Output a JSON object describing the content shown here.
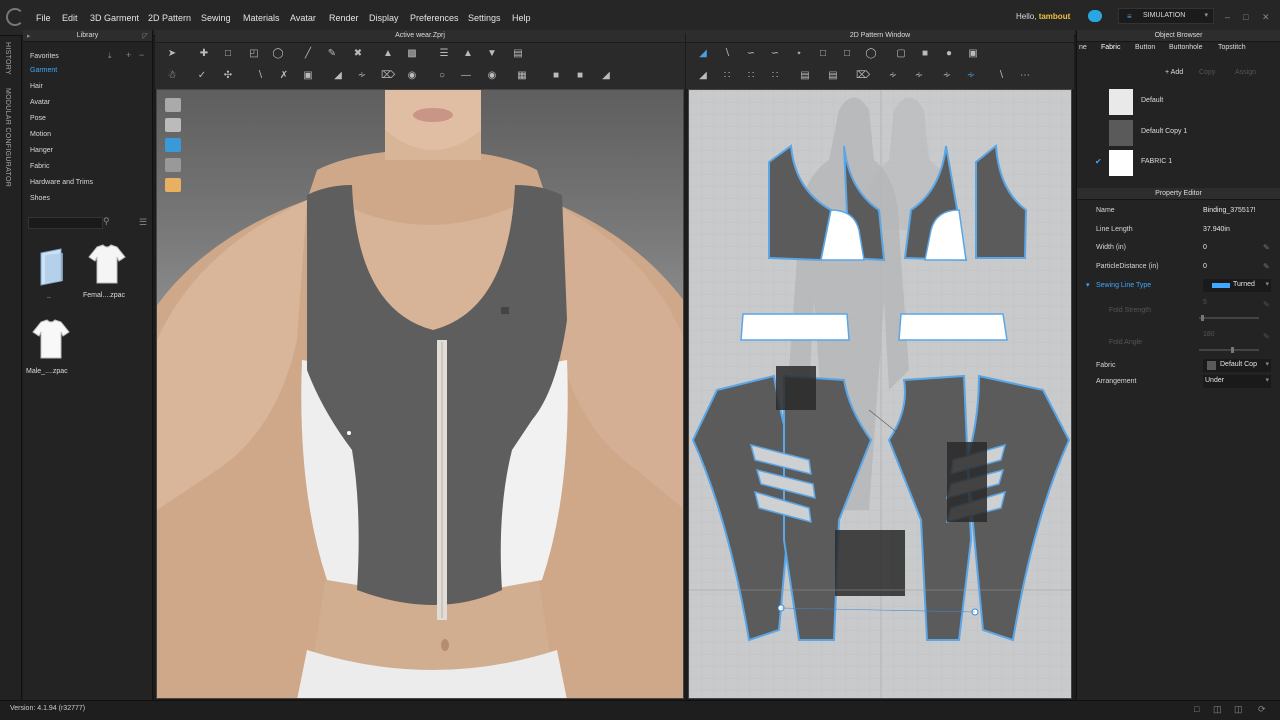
{
  "menu": [
    "File",
    "Edit",
    "3D Garment",
    "2D Pattern",
    "Sewing",
    "Materials",
    "Avatar",
    "Render",
    "Display",
    "Preferences",
    "Settings",
    "Help"
  ],
  "greeting": {
    "prefix": "Hello,",
    "user": "tambout"
  },
  "simulation_label": "SIMULATION",
  "side_tabs": {
    "history": "HISTORY",
    "modular": "MODULAR CONFIGURATOR"
  },
  "library": {
    "title": "Library",
    "items": [
      "Favorites",
      "Garment",
      "Hair",
      "Avatar",
      "Pose",
      "Motion",
      "Hanger",
      "Fabric",
      "Hardware and Trims",
      "Shoes"
    ],
    "selected": "Garment",
    "files": [
      {
        "label": ".."
      },
      {
        "label": "Femal....zpac"
      },
      {
        "label": "Male_....zpac"
      }
    ]
  },
  "view3d": {
    "title": "Active wear.Zprj"
  },
  "view2d": {
    "title": "2D Pattern Window"
  },
  "object_browser": {
    "title": "Object Browser",
    "tabs": [
      "ne",
      "Fabric",
      "Button",
      "Buttonhole",
      "Topstitch"
    ],
    "active_tab": "Fabric",
    "actions": {
      "add": "Add",
      "copy": "Copy",
      "assign": "Assign"
    },
    "fabrics": [
      {
        "name": "Default",
        "swatch": "#e9e9e9",
        "checked": false
      },
      {
        "name": "Default Copy 1",
        "swatch": "#5a5a5a",
        "checked": false
      },
      {
        "name": "FABRIC 1",
        "swatch": "#ffffff",
        "checked": true
      }
    ]
  },
  "property_editor": {
    "title": "Property Editor",
    "name": {
      "label": "Name",
      "value": "Binding_375517!"
    },
    "line_length": {
      "label": "Line Length",
      "value": "37.940in"
    },
    "width": {
      "label": "Width (in)",
      "value": "0"
    },
    "particle_distance": {
      "label": "ParticleDistance (in)",
      "value": "0"
    },
    "sewing_line_type": {
      "label": "Sewing Line Type",
      "value": "Turned"
    },
    "fold_strength": {
      "label": "Fold Strength",
      "value": "5"
    },
    "fold_angle": {
      "label": "Fold Angle",
      "value": "180"
    },
    "fabric": {
      "label": "Fabric",
      "value": "Default Cop"
    },
    "arrangement": {
      "label": "Arrangement",
      "value": "Under"
    }
  },
  "status": {
    "version": "Version: 4.1.94 (r32777)"
  },
  "colors": {
    "accent": "#3ea9ff",
    "bg": "#232323",
    "pattern_fill": "#5b5b5b",
    "pattern_edge": "#5aa6e6"
  }
}
